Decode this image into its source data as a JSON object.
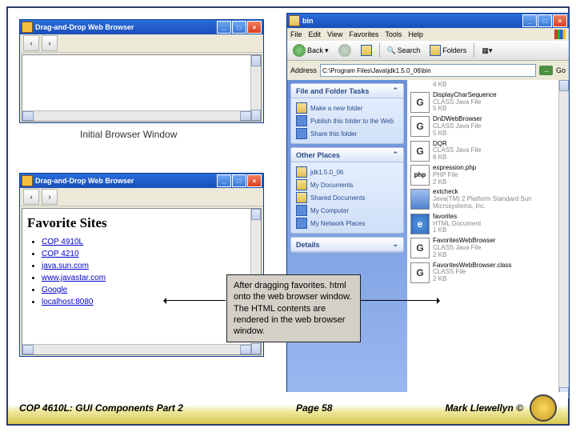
{
  "initial_browser": {
    "title": "Drag-and-Drop Web Browser",
    "caption": "Initial Browser Window"
  },
  "after_browser": {
    "title": "Drag-and-Drop Web Browser",
    "heading": "Favorite Sites",
    "links": [
      "COP 4910L",
      "COP 4210",
      "java.sun.com",
      "www.javastar.com",
      "Google",
      "localhost:8080"
    ]
  },
  "callout": {
    "text": "After dragging favorites. html onto the web browser window. The HTML contents are rendered in the web browser window."
  },
  "explorer": {
    "folder_title": "bin",
    "menu": [
      "File",
      "Edit",
      "View",
      "Favorites",
      "Tools",
      "Help"
    ],
    "toolbar": {
      "back": "Back",
      "search": "Search",
      "folders": "Folders"
    },
    "address_label": "Address",
    "address_value": "C:\\Program Files\\Java\\jdk1.5.0_06\\bin",
    "go": "Go",
    "tasks_panel": {
      "title": "File and Folder Tasks",
      "items": [
        "Make a new folder",
        "Publish this folder to the Web",
        "Share this folder"
      ]
    },
    "places_panel": {
      "title": "Other Places",
      "items": [
        "jdk1.5.0_06",
        "My Documents",
        "Shared Documents",
        "My Computer",
        "My Network Places"
      ]
    },
    "details_panel": {
      "title": "Details"
    },
    "files": [
      {
        "size": "4 KB"
      },
      {
        "name": "DisplayCharSequence",
        "type": "CLASS Java File",
        "size": "5 KB"
      },
      {
        "name": "DnDWebBrowser",
        "type": "CLASS Java File",
        "size": "5 KB"
      },
      {
        "name": "DQR",
        "type": "CLASS Java File",
        "size": "6 KB"
      },
      {
        "name": "expression.php",
        "type": "PHP File",
        "size": "2 KB"
      },
      {
        "name": "extcheck",
        "type": "Java(TM) 2 Platform Standard Sun Microsystems, Inc.",
        "size": ""
      },
      {
        "name": "favorites",
        "type": "HTML Document",
        "size": "1 KB"
      },
      {
        "name": "FavoritesWebBrowser",
        "type": "CLASS Java File",
        "size": "2 KB"
      },
      {
        "name": "FavoritesWebBrowser.class",
        "type": "CLASS File",
        "size": "2 KB"
      }
    ]
  },
  "footer": {
    "left": "COP 4610L: GUI Components Part 2",
    "center": "Page 58",
    "right": "Mark Llewellyn ©"
  }
}
